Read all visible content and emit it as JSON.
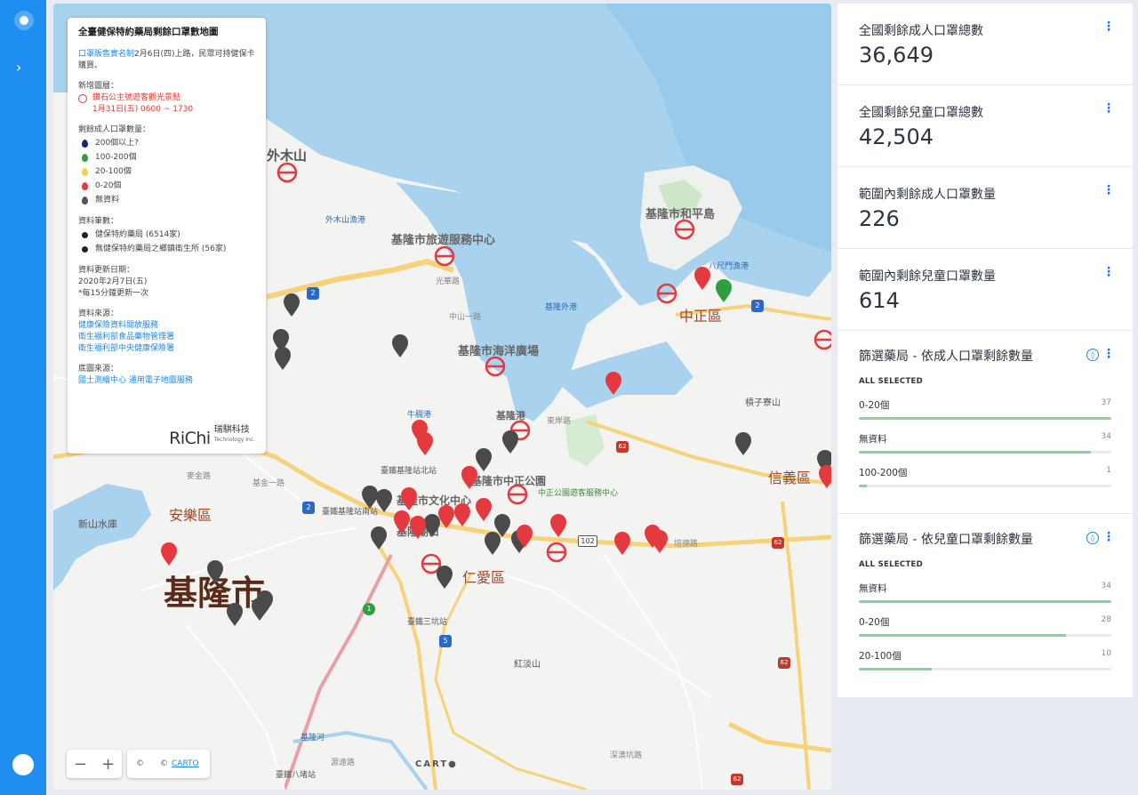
{
  "legend": {
    "title": "全臺健保特約藥局剩餘口罩數地圖",
    "intro_link": "口罩販售實名制",
    "intro_text": "2月6日(四)上路，民眾可持健保卡購買。",
    "new_layer_label": "新增圖層：",
    "new_layer_name": "鑽石公主號遊客觀光景點",
    "new_layer_date": "1月31日(五) 0600 ~ 1730",
    "mask_count_label": "剩餘成人口罩數量：",
    "mask_levels": [
      {
        "label": "200個以上?",
        "color": "#1a237e"
      },
      {
        "label": "100-200個",
        "color": "#2e9e3e"
      },
      {
        "label": "20-100個",
        "color": "#f2d24b"
      },
      {
        "label": "0-20個",
        "color": "#e53940"
      },
      {
        "label": "無資料",
        "color": "#555555"
      }
    ],
    "record_label": "資料筆數：",
    "records": [
      {
        "label": "健保特約藥局 (6514家)"
      },
      {
        "label": "無健保特約藥局之鄉鎮衛生所 (56家)"
      }
    ],
    "update_label": "資料更新日期：",
    "update_date": "2020年2月7日(五)",
    "update_note": "*每15分鐘更新一次",
    "source_label": "資料來源：",
    "sources": [
      "健康保險資料開放服務",
      "衛生福利部食品藥物管理署",
      "衛生福利部中央健康保險署"
    ],
    "basemap_label": "底圖來源：",
    "basemap_source": "國土測繪中心 通用電子地圖服務",
    "brand_latin": "RiChi",
    "brand_zh": "瑞騏科技",
    "brand_en": "Technology Inc."
  },
  "map_controls": {
    "zoom_out": "−",
    "zoom_in": "+",
    "attrib_symbol": "©",
    "attrib_prefix": "©",
    "attrib_link": "CARTO",
    "carto_logo": "CART●"
  },
  "map_labels": {
    "city": "基隆市",
    "districts": [
      "安樂區",
      "中正區",
      "仁愛區",
      "信義區"
    ],
    "places": [
      "外木山",
      "基隆市旅遊服務中心",
      "基隆市和平島",
      "基隆市海洋廣場",
      "基隆市中正公園",
      "基隆市文化中心",
      "基隆廟口",
      "中正公園遊客服務中心",
      "基隆港",
      "牛稠港",
      "外木山漁港",
      "八尺門漁港",
      "基隆外港",
      "臺鐵基隆站北站",
      "臺鐵基隆站南站",
      "臺鐵三坑站",
      "臺鐵八堵站",
      "新山水庫",
      "槓子寮山",
      "紅淡山",
      "麥金路",
      "基金一路",
      "中山一路",
      "光華路",
      "東岸路",
      "培德路",
      "基隆河",
      "深澳坑路",
      "源遠路"
    ],
    "route_shields": [
      "2",
      "2",
      "2",
      "1",
      "5",
      "102",
      "62",
      "62",
      "62",
      "62"
    ]
  },
  "stats": [
    {
      "title": "全國剩餘成人口罩總數",
      "value": "36,649"
    },
    {
      "title": "全國剩餘兒童口罩總數",
      "value": "42,504"
    },
    {
      "title": "範圍內剩餘成人口罩數量",
      "value": "226"
    },
    {
      "title": "範圍內剩餘兒童口罩數量",
      "value": "614"
    }
  ],
  "filters": [
    {
      "title": "篩選藥局 - 依成人口罩剩餘數量",
      "selected": "ALL SELECTED",
      "items": [
        {
          "label": "0-20個",
          "count": "37",
          "fraction": 1.0
        },
        {
          "label": "無資料",
          "count": "34",
          "fraction": 0.92
        },
        {
          "label": "100-200個",
          "count": "1",
          "fraction": 0.03
        }
      ]
    },
    {
      "title": "篩選藥局 - 依兒童口罩剩餘數量",
      "selected": "ALL SELECTED",
      "items": [
        {
          "label": "無資料",
          "count": "34",
          "fraction": 1.0
        },
        {
          "label": "0-20個",
          "count": "28",
          "fraction": 0.82
        },
        {
          "label": "20-100個",
          "count": "10",
          "fraction": 0.29
        }
      ]
    }
  ],
  "colors": {
    "accent": "#1e8ef0",
    "water": "#a9d2ee",
    "pin_red": "#e53940",
    "pin_gray": "#4a4a4a",
    "pin_green": "#2e9e3e",
    "bar": "#8fd19e"
  }
}
